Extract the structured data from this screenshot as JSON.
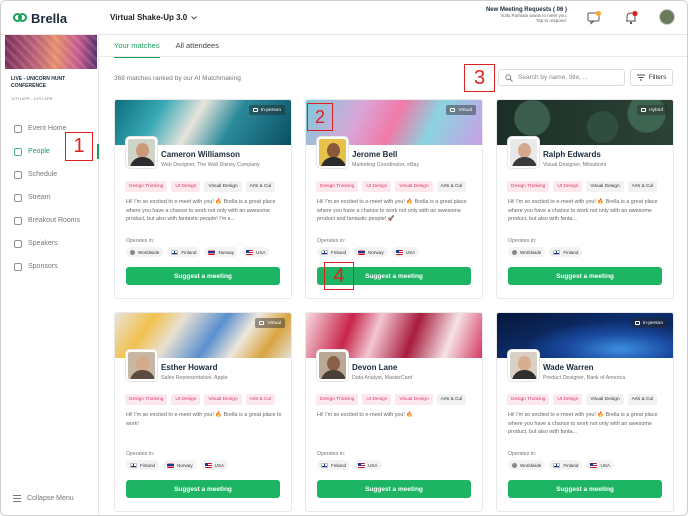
{
  "app": {
    "logo": "Brella",
    "event_selector": "Virtual Shake-Up 3.0"
  },
  "header": {
    "meeting_requests_title": "New Meeting Requests ( 06 )",
    "meeting_requests_sub1": "Vollu Parhiala wants to meet you.",
    "meeting_requests_sub2": "Tap to respond.",
    "icons": [
      "chat-icon",
      "bell-icon",
      "avatar"
    ],
    "chat_badge": "",
    "bell_badge": ""
  },
  "sidebar": {
    "event_name": "LIVE - UNICORN HUNT CONFERENCE",
    "event_dates": "12TH APR - 14TH APR",
    "items": [
      {
        "label": "Event Home",
        "icon": "home-icon",
        "active": false
      },
      {
        "label": "People",
        "icon": "people-icon",
        "active": true
      },
      {
        "label": "Schedule",
        "icon": "calendar-icon",
        "active": false
      },
      {
        "label": "Stream",
        "icon": "stream-icon",
        "active": false
      },
      {
        "label": "Breakout Rooms",
        "icon": "rooms-icon",
        "active": false
      },
      {
        "label": "Speakers",
        "icon": "speakers-icon",
        "active": false
      },
      {
        "label": "Sponsors",
        "icon": "sponsors-icon",
        "active": false
      }
    ],
    "collapse_label": "Collapse Menu"
  },
  "main": {
    "tabs": [
      {
        "label": "Your matches",
        "active": true
      },
      {
        "label": "All attendees",
        "active": false
      }
    ],
    "matches_count": "368 matches ranked by our AI Matchmaking",
    "search": {
      "placeholder": "Search by name, title, ..."
    },
    "filters_label": "Filters",
    "operates_label": "Operates in:",
    "suggest_label": "Suggest a meeting",
    "cards": [
      {
        "name": "Cameron Williamson",
        "title": "Web Designer, The Walt Disney Company",
        "mode": "In-person",
        "tags": [
          "Design Thinking",
          "UI Design",
          "Visual Design",
          "Arts & Cul"
        ],
        "bio": "Hi! I'm so excited to e-meet with you! 🔥 Brella is a great place where you have a chance to work not only with an awesome product, but also with fantastic people! I'm s...",
        "places": [
          "Worldwide",
          "Finland",
          "Norway",
          "USA"
        ]
      },
      {
        "name": "Jerome Bell",
        "title": "Marketing Coordinator, eBay",
        "mode": "Virtual",
        "tags": [
          "Design Thinking",
          "UI Design",
          "Visual Design",
          "Arts & Cul"
        ],
        "bio": "Hi! I'm so excited to e-meet with you! 🔥 Brella is a great place where you have a chance to work not only with an awesome product and fantastic people! 🚀",
        "places": [
          "Finland",
          "Norway",
          "USA"
        ]
      },
      {
        "name": "Ralph Edwards",
        "title": "Visual Designer, Mitsubishi",
        "mode": "Hybrid",
        "tags": [
          "Design Thinking",
          "UI Design",
          "Visual Design",
          "Arts & Cul"
        ],
        "bio": "Hi! I'm so excited to e-meet with you! 🔥 Brella is a great place where you have a chance to work not only with an awesome product, but also with fanta...",
        "places": [
          "Worldwide",
          "Finland"
        ]
      },
      {
        "name": "Esther Howard",
        "title": "Sales Representative, Apple",
        "mode": "Virtual",
        "tags": [
          "Design Thinking",
          "UI Design",
          "Visual Design",
          "Arts & Cul"
        ],
        "bio": "Hi! I'm so excited to e-meet with you! 🔥 Brella is a great place to work!",
        "places": [
          "Finland",
          "Norway",
          "USA"
        ]
      },
      {
        "name": "Devon Lane",
        "title": "Data Analyst, MasterCard",
        "mode": "",
        "tags": [
          "Design Thinking",
          "UI Design",
          "Visual Design",
          "Arts & Cul"
        ],
        "bio": "Hi! I'm so excited to e-meet with you! 🔥",
        "places": [
          "Finland",
          "USA"
        ]
      },
      {
        "name": "Wade Warren",
        "title": "Product Designer, Bank of America",
        "mode": "In-person",
        "tags": [
          "Design Thinking",
          "UI Design",
          "Visual Design",
          "Arts & Cul"
        ],
        "bio": "Hi! I'm so excited to e-meet with you! 🔥 Brella is a great place where you have a chance to work not only with an awesome product, but also with fanta...",
        "places": [
          "Worldwide",
          "Finland",
          "USA"
        ]
      }
    ]
  },
  "annotations": [
    "1",
    "2",
    "3",
    "4"
  ],
  "colors": {
    "accent": "#1db563",
    "tag_pink": "#d63a6a",
    "annotation": "#e02020"
  }
}
